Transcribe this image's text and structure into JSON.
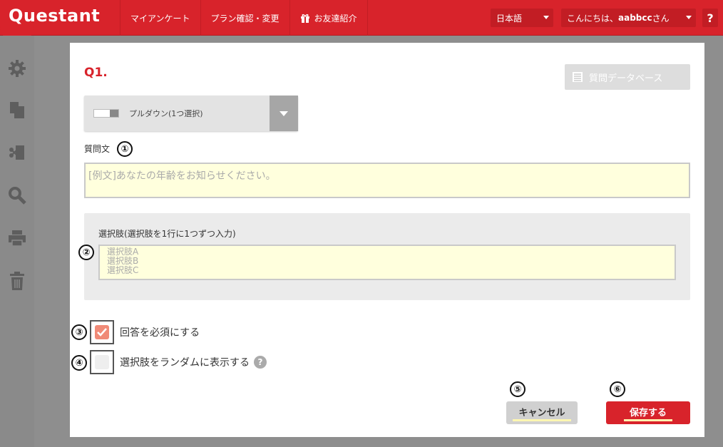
{
  "header": {
    "logo": "Questant",
    "nav": [
      "マイアンケート",
      "プラン確認・変更",
      "お友達紹介"
    ],
    "language": "日本語",
    "greeting_prefix": "こんにちは、",
    "username": "aabbcc",
    "greeting_suffix": "さん",
    "help": "?"
  },
  "sidebar": {
    "icons": [
      "gear-icon",
      "copy-icon",
      "logic-icon",
      "search-icon",
      "print-icon",
      "trash-icon"
    ]
  },
  "question": {
    "number": "Q1.",
    "db_button": "質問データベース",
    "type_label": "プルダウン(1つ選択)",
    "text_label": "質問文",
    "text_placeholder": "[例文]あなたの年齢をお知らせください。",
    "choices_label": "選択肢(選択肢を1行に1つずつ入力)",
    "choices_placeholder_lines": [
      "選択肢A",
      "選択肢B",
      "選択肢C"
    ],
    "required_label": "回答を必須にする",
    "required_checked": true,
    "random_label": "選択肢をランダムに表示する",
    "random_checked": false,
    "random_help": "?"
  },
  "buttons": {
    "cancel": "キャンセル",
    "save": "保存する"
  },
  "annotations": [
    "①",
    "②",
    "③",
    "④",
    "⑤",
    "⑥"
  ],
  "colors": {
    "brand": "#d8232b",
    "input_bg": "#ffffdd",
    "checked": "#f08a77"
  }
}
